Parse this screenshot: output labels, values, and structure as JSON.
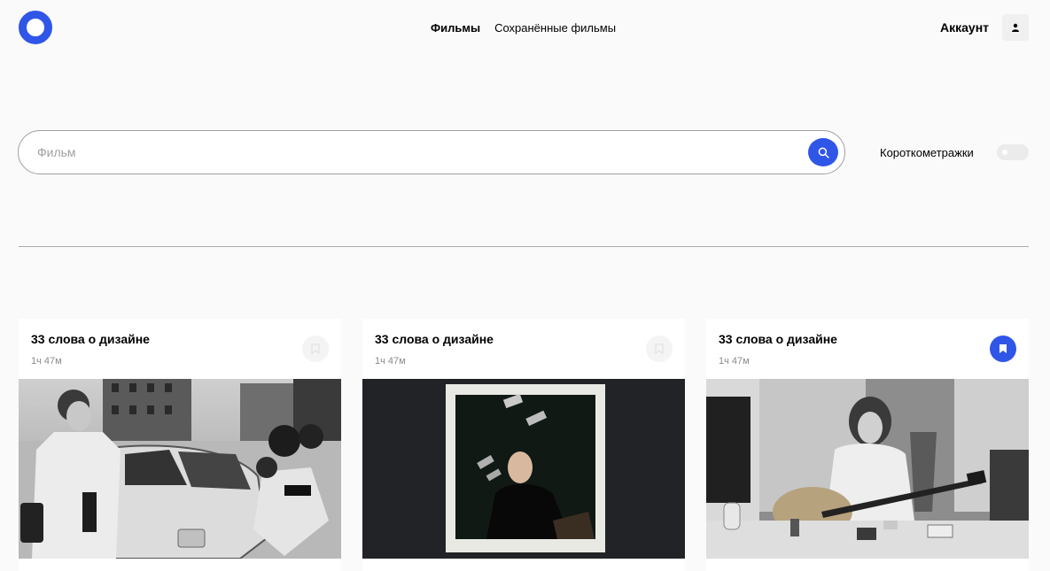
{
  "header": {
    "logo_icon": "ring-logo",
    "nav": [
      {
        "label": "Фильмы",
        "active": true
      },
      {
        "label": "Сохранённые фильмы",
        "active": false
      }
    ],
    "account_label": "Аккаунт",
    "account_icon": "user-icon"
  },
  "search": {
    "placeholder": "Фильм",
    "value": "",
    "button_icon": "search-icon"
  },
  "filter": {
    "shorts_label": "Короткометражки",
    "shorts_enabled": false
  },
  "colors": {
    "accent": "#3056e8",
    "background": "#fafafa",
    "card": "#ffffff",
    "muted_text": "#8a8a8a"
  },
  "movies": [
    {
      "title": "33 слова о дизайне",
      "duration": "1ч 47м",
      "saved": false,
      "image": "street-photo-bw"
    },
    {
      "title": "33 слова о дизайне",
      "duration": "1ч 47м",
      "saved": false,
      "image": "polaroid-portrait"
    },
    {
      "title": "33 слова о дизайне",
      "duration": "1ч 47м",
      "saved": true,
      "image": "guitarist-photo-bw"
    }
  ]
}
